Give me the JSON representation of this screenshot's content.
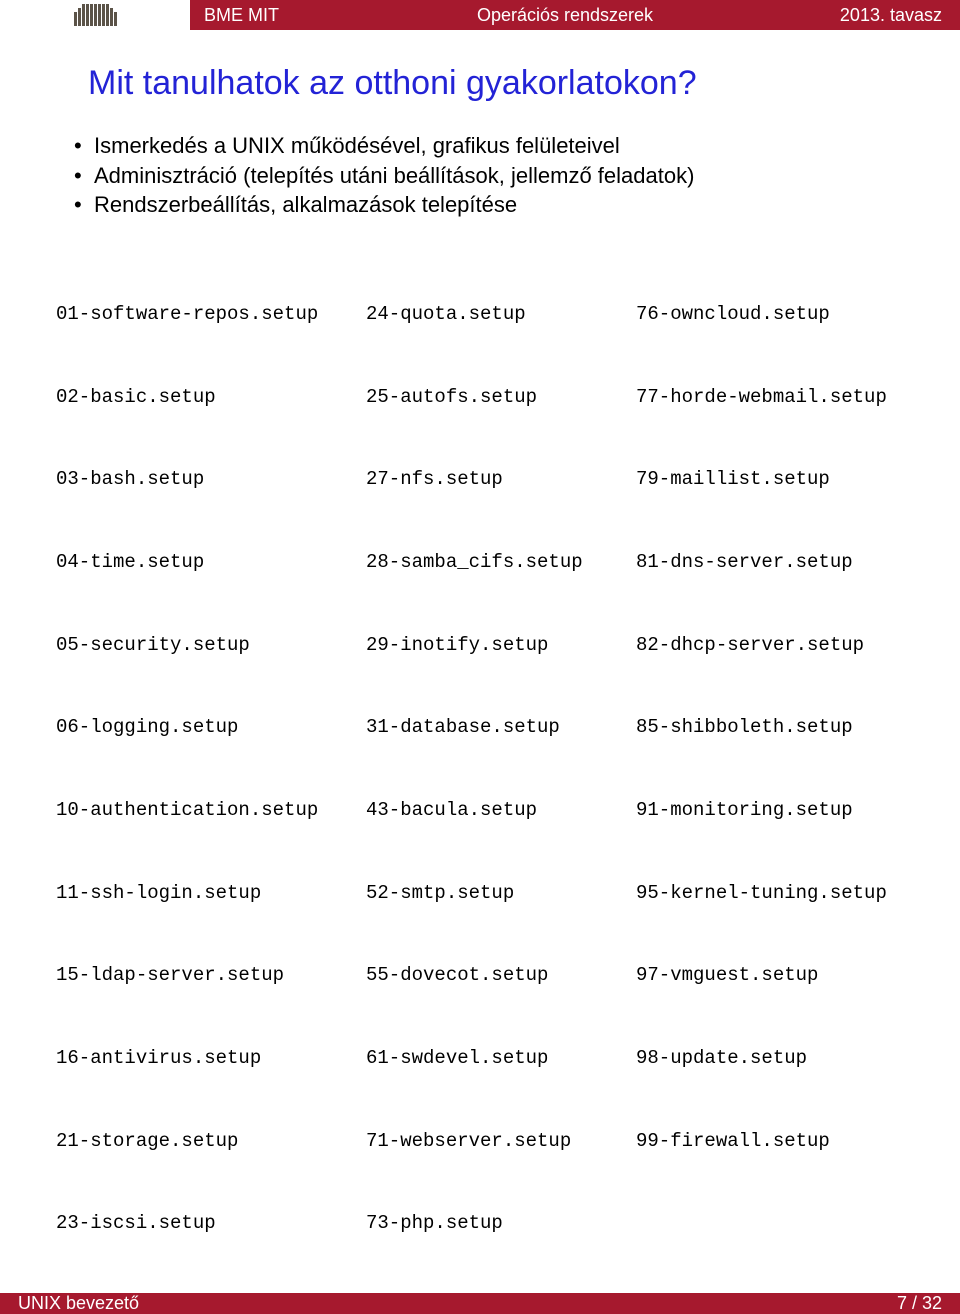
{
  "header": {
    "left": "BME MIT",
    "center": "Operációs rendszerek",
    "right": "2013. tavasz"
  },
  "title": "Mit tanulhatok az otthoni gyakorlatokon?",
  "bullets": [
    "Ismerkedés a UNIX működésével, grafikus felületeivel",
    "Adminisztráció (telepítés utáni beállítások, jellemző feladatok)",
    "Rendszerbeállítás, alkalmazások telepítése"
  ],
  "files": {
    "col1": [
      "01-software-repos.setup",
      "02-basic.setup",
      "03-bash.setup",
      "04-time.setup",
      "05-security.setup",
      "06-logging.setup",
      "10-authentication.setup",
      "11-ssh-login.setup",
      "15-ldap-server.setup",
      "16-antivirus.setup",
      "21-storage.setup",
      "23-iscsi.setup"
    ],
    "col2": [
      "24-quota.setup",
      "25-autofs.setup",
      "27-nfs.setup",
      "28-samba_cifs.setup",
      "29-inotify.setup",
      "31-database.setup",
      "43-bacula.setup",
      "52-smtp.setup",
      "55-dovecot.setup",
      "61-swdevel.setup",
      "71-webserver.setup",
      "73-php.setup"
    ],
    "col3": [
      "76-owncloud.setup",
      "77-horde-webmail.setup",
      "79-maillist.setup",
      "81-dns-server.setup",
      "82-dhcp-server.setup",
      "85-shibboleth.setup",
      "91-monitoring.setup",
      "95-kernel-tuning.setup",
      "97-vmguest.setup",
      "98-update.setup",
      "99-firewall.setup"
    ]
  },
  "footer": {
    "left": "UNIX bevezető",
    "right": "7 / 32"
  }
}
